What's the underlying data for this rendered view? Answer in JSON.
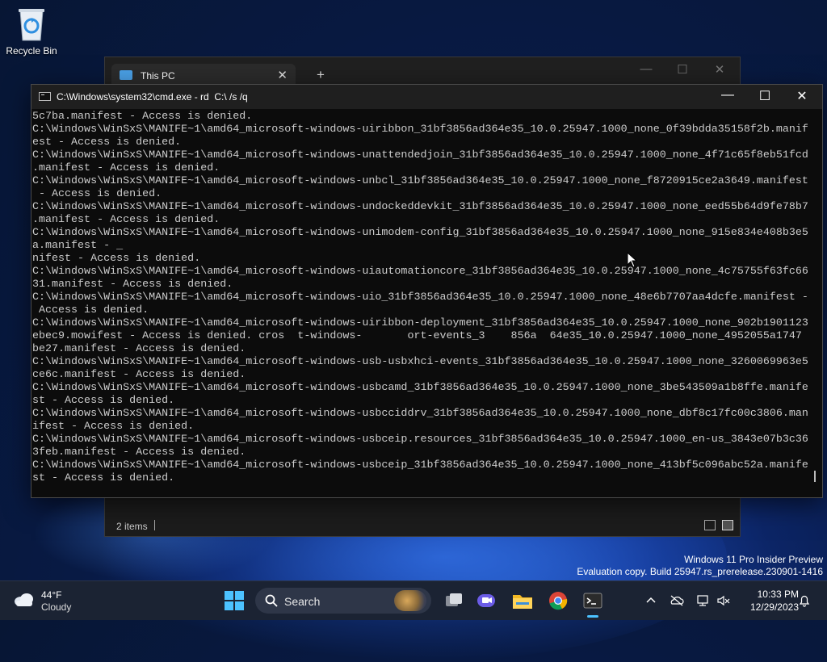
{
  "desktop": {
    "recycle_bin_label": "Recycle Bin"
  },
  "explorer": {
    "tab_title": "This PC",
    "tab_close": "✕",
    "new_tab": "+",
    "minimize": "—",
    "maximize": "☐",
    "close": "✕",
    "status_items": "2 items"
  },
  "cmd": {
    "title": "C:\\Windows\\system32\\cmd.exe - rd  C:\\ /s /q",
    "minimize": "—",
    "maximize": "☐",
    "close": "✕",
    "lines": [
      "5c7ba.manifest - Access is denied.",
      "C:\\Windows\\WinSxS\\MANIFE~1\\amd64_microsoft-windows-uiribbon_31bf3856ad364e35_10.0.25947.1000_none_0f39bdda35158f2b.manif",
      "est - Access is denied.",
      "C:\\Windows\\WinSxS\\MANIFE~1\\amd64_microsoft-windows-unattendedjoin_31bf3856ad364e35_10.0.25947.1000_none_4f71c65f8eb51fcd",
      ".manifest - Access is denied.",
      "C:\\Windows\\WinSxS\\MANIFE~1\\amd64_microsoft-windows-unbcl_31bf3856ad364e35_10.0.25947.1000_none_f8720915ce2a3649.manifest",
      " - Access is denied.",
      "C:\\Windows\\WinSxS\\MANIFE~1\\amd64_microsoft-windows-undockeddevkit_31bf3856ad364e35_10.0.25947.1000_none_eed55b64d9fe78b7",
      ".manifest - Access is denied.",
      "C:\\Windows\\WinSxS\\MANIFE~1\\amd64_microsoft-windows-unimodem-config_31bf3856ad364e35_10.0.25947.1000_none_915e834e408b3e5",
      "a.manifest - _",
      "nifest - Access is denied.",
      "C:\\Windows\\WinSxS\\MANIFE~1\\amd64_microsoft-windows-uiautomationcore_31bf3856ad364e35_10.0.25947.1000_none_4c75755f63fc66",
      "31.manifest - Access is denied.",
      "C:\\Windows\\WinSxS\\MANIFE~1\\amd64_microsoft-windows-uio_31bf3856ad364e35_10.0.25947.1000_none_48e6b7707aa4dcfe.manifest -",
      " Access is denied.",
      "C:\\Windows\\WinSxS\\MANIFE~1\\amd64_microsoft-windows-uiribbon-deployment_31bf3856ad364e35_10.0.25947.1000_none_902b1901123",
      "ebec9.mowifest - Access is denied. cros  t-windows-       ort-events_3    856a  64e35_10.0.25947.1000_none_4952055a1747",
      "be27.manifest - Access is denied.",
      "C:\\Windows\\WinSxS\\MANIFE~1\\amd64_microsoft-windows-usb-usbxhci-events_31bf3856ad364e35_10.0.25947.1000_none_3260069963e5",
      "ce6c.manifest - Access is denied.",
      "C:\\Windows\\WinSxS\\MANIFE~1\\amd64_microsoft-windows-usbcamd_31bf3856ad364e35_10.0.25947.1000_none_3be543509a1b8ffe.manife",
      "st - Access is denied.",
      "C:\\Windows\\WinSxS\\MANIFE~1\\amd64_microsoft-windows-usbcciddrv_31bf3856ad364e35_10.0.25947.1000_none_dbf8c17fc00c3806.man",
      "ifest - Access is denied.",
      "C:\\Windows\\WinSxS\\MANIFE~1\\amd64_microsoft-windows-usbceip.resources_31bf3856ad364e35_10.0.25947.1000_en-us_3843e07b3c36",
      "3feb.manifest - Access is denied.",
      "C:\\Windows\\WinSxS\\MANIFE~1\\amd64_microsoft-windows-usbceip_31bf3856ad364e35_10.0.25947.1000_none_413bf5c096abc52a.manife",
      "st - Access is denied."
    ]
  },
  "watermark": {
    "line1": "Windows 11 Pro Insider Preview",
    "line2": "Evaluation copy. Build 25947.rs_prerelease.230901-1416"
  },
  "taskbar": {
    "weather_temp": "44°F",
    "weather_condition": "Cloudy",
    "search_label": "Search",
    "time": "10:33 PM",
    "date": "12/29/2023",
    "accent": "#4cc2ff"
  }
}
